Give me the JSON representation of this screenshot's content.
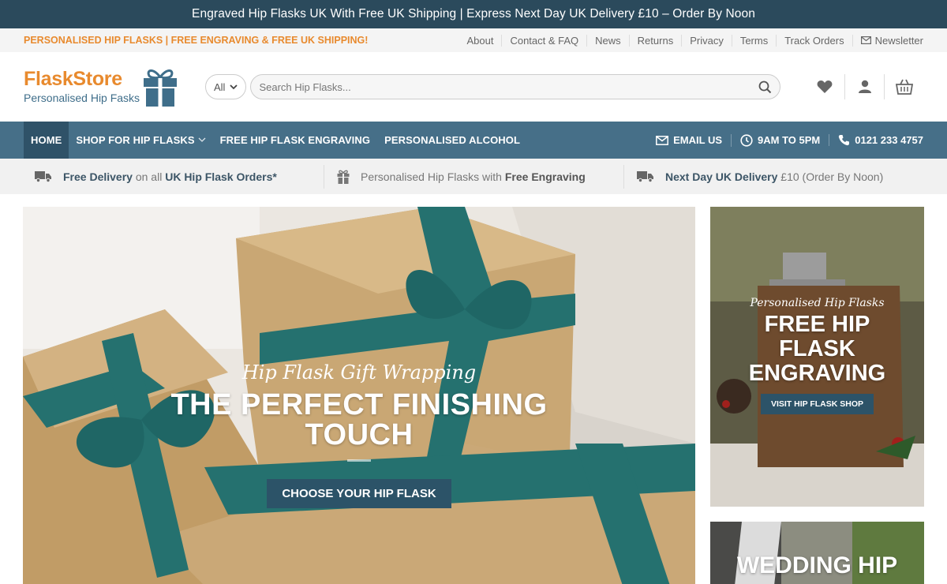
{
  "announcement": "Engraved Hip Flasks UK With Free UK Shipping | Express Next Day UK Delivery £10 – Order By Noon",
  "utility": {
    "promo": "PERSONALISED HIP FLASKS | FREE ENGRAVING & FREE UK SHIPPING!",
    "links": [
      "About",
      "Contact & FAQ",
      "News",
      "Returns",
      "Privacy",
      "Terms",
      "Track Orders",
      "Newsletter"
    ]
  },
  "logo": {
    "brand": "FlaskStore",
    "tagline": "Personalised Hip Fasks"
  },
  "search": {
    "category": "All",
    "placeholder": "Search Hip Flasks..."
  },
  "nav": {
    "items": [
      "HOME",
      "SHOP FOR HIP FLASKS",
      "FREE HIP FLASK ENGRAVING",
      "PERSONALISED ALCOHOL"
    ],
    "email": "EMAIL US",
    "hours": "9AM TO 5PM",
    "phone": "0121 233 4757"
  },
  "features": {
    "f1": {
      "bold1": "Free Delivery",
      "text1": " on all ",
      "bold2": "UK Hip Flask Orders*"
    },
    "f2": {
      "text1": "Personalised Hip Flasks with ",
      "bold1": "Free Engraving"
    },
    "f3": {
      "bold1": "Next Day UK Delivery",
      "text1": " £10 (Order By Noon)"
    }
  },
  "hero": {
    "script": "Hip Flask Gift Wrapping",
    "title_line1": "THE PERFECT FINISHING",
    "title_line2": "TOUCH",
    "button": "CHOOSE YOUR HIP FLASK"
  },
  "side1": {
    "script": "Personalised Hip Flasks",
    "title_line1": "FREE HIP",
    "title_line2": "FLASK",
    "title_line3": "ENGRAVING",
    "button": "VISIT HIP FLASK SHOP"
  },
  "side2": {
    "title": "WEDDING HIP"
  },
  "colors": {
    "primary": "#466f88",
    "dark": "#2b4a5c",
    "accent": "#e88a2e",
    "button": "#2c5368"
  }
}
